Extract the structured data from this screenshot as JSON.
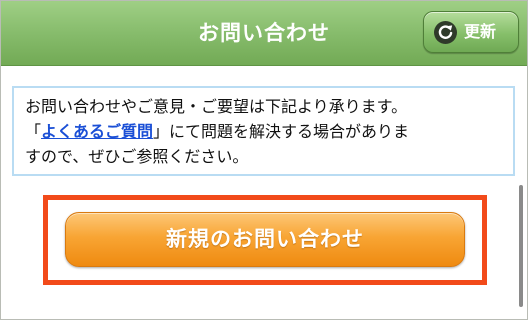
{
  "header": {
    "title": "お問い合わせ",
    "refresh_label": "更新",
    "refresh_icon": "refresh-icon"
  },
  "notice": {
    "line1": "お問い合わせやご意見・ご要望は下記より承ります。",
    "line2_open": "「",
    "faq_link": "よくあるご質問",
    "line2_close": "」にて問題を解決する場合がありま",
    "line3": "すので、ぜひご参照ください。"
  },
  "main": {
    "new_inquiry_label": "新規のお問い合わせ"
  },
  "colors": {
    "header_green": "#87bc6c",
    "button_orange": "#f8a534",
    "highlight_red": "#f24a1a",
    "link_blue": "#1a4fd6",
    "notice_border": "#b9dcf3"
  }
}
